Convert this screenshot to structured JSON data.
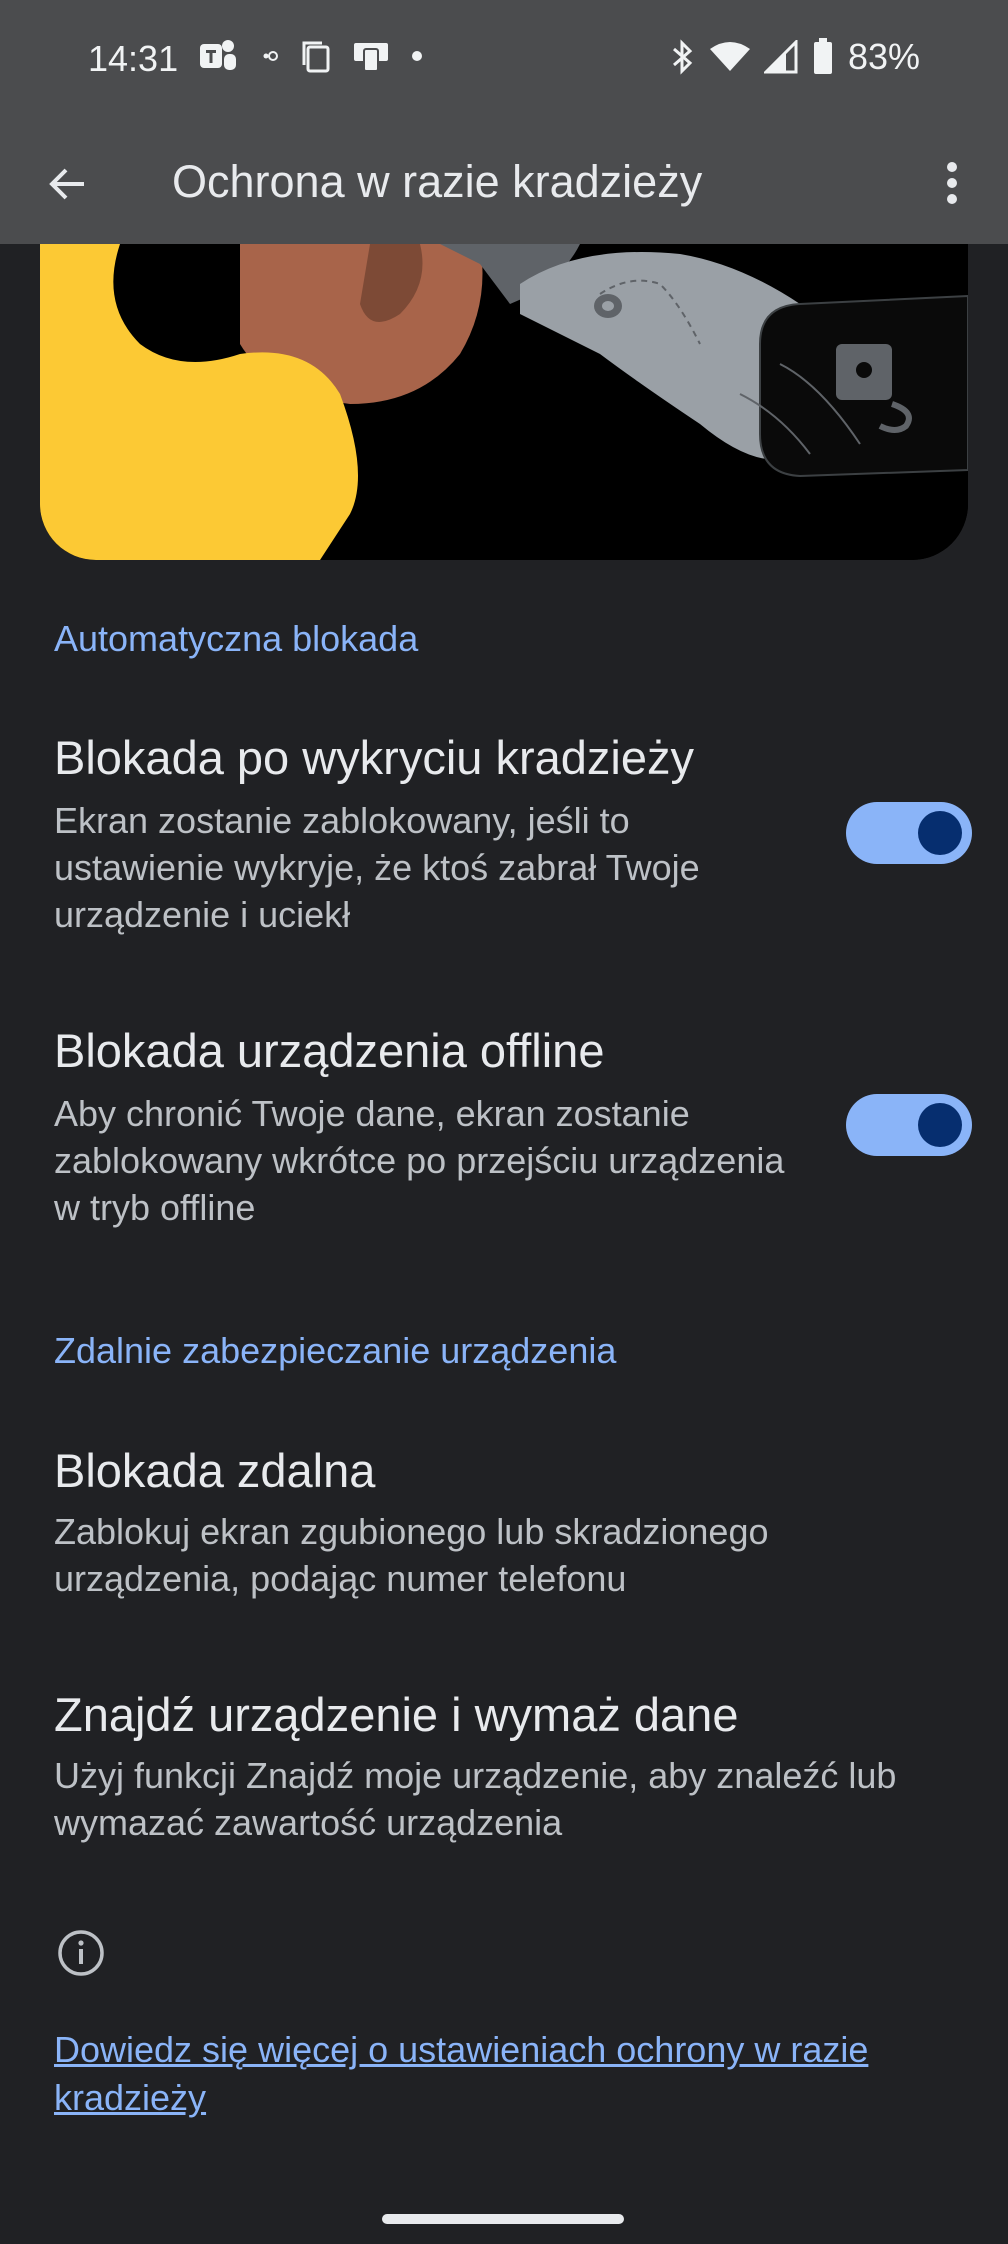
{
  "status_bar": {
    "time": "14:31",
    "battery": "83%",
    "icons": [
      "teams-icon",
      "dot-circle-icon",
      "copy-icon",
      "cast-device-icon",
      "dot-icon",
      "bluetooth-icon",
      "wifi-icon",
      "signal-icon",
      "battery-icon"
    ]
  },
  "app_bar": {
    "title": "Ochrona w razie kradzieży"
  },
  "sections": [
    {
      "header": "Automatyczna blokada"
    },
    {
      "header": "Zdalnie zabezpieczanie urządzenia"
    }
  ],
  "items": {
    "theft_lock": {
      "title": "Blokada po wykryciu kradzieży",
      "desc": "Ekran zostanie zablokowany, jeśli to ustawienie wykryje, że ktoś zabrał Twoje urządzenie i uciekł",
      "enabled": true
    },
    "offline_lock": {
      "title": "Blokada urządzenia offline",
      "desc": "Aby chronić Twoje dane, ekran zostanie zablokowany wkrótce po przejściu urządzenia w tryb offline",
      "enabled": true
    },
    "remote_lock": {
      "title": "Blokada zdalna",
      "desc": "Zablokuj ekran zgubionego lub skradzionego urządzenia, podając numer telefonu"
    },
    "find_device": {
      "title": "Znajdź urządzenie i wymaż dane",
      "desc": "Użyj funkcji Znajdź moje urządzenie, aby znaleźć lub wymazać zawartość urządzenia"
    }
  },
  "footer": {
    "learn_more": "Dowiedz się więcej o ustawieniach ochrony w razie kradzieży"
  },
  "colors": {
    "accent": "#8ab4f8",
    "background": "#202124",
    "app_bar": "#4b4c4e"
  }
}
